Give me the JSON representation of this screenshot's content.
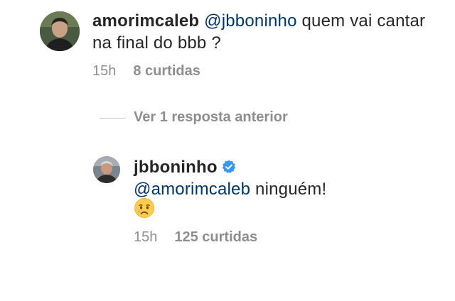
{
  "comment_1": {
    "username": "amorimcaleb",
    "mention": "@jbboninho",
    "text": " quem vai cantar na final do bbb ?",
    "time": "15h",
    "likes": "8 curtidas"
  },
  "replies_toggle": "Ver 1 resposta anterior",
  "comment_2": {
    "username": "jbboninho",
    "mention": "@amorimcaleb",
    "text": " ninguém!",
    "emoji": "crying-face",
    "time": "15h",
    "likes": "125 curtidas"
  },
  "colors": {
    "text": "#262626",
    "mention": "#00376b",
    "meta": "#8e8e8e",
    "verified": "#3897f0"
  }
}
